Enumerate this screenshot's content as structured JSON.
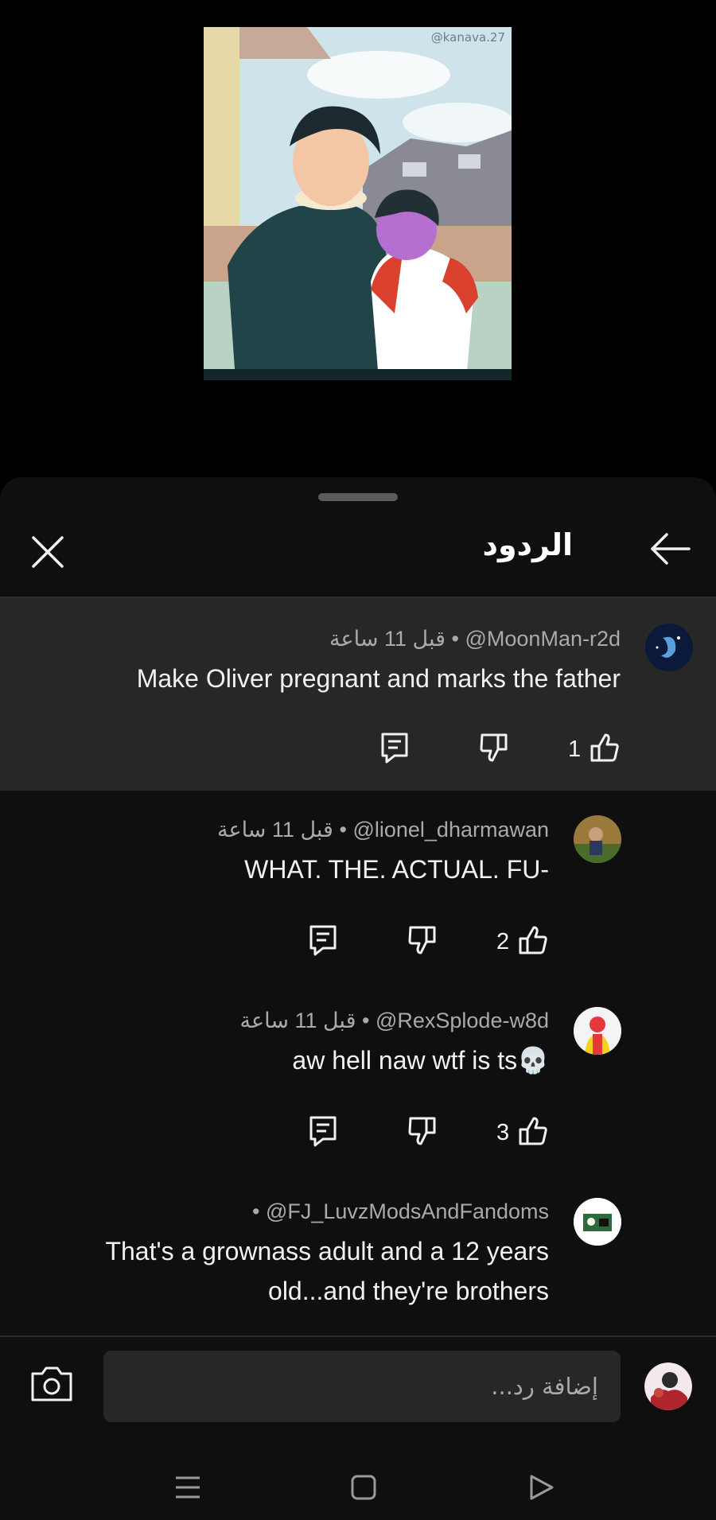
{
  "video": {
    "watermark": "@kanava.27"
  },
  "sheet": {
    "title": "الردود",
    "close_icon": "close-icon",
    "back_icon": "arrow-back-icon"
  },
  "comments": [
    {
      "author": "@MoonMan-r2d",
      "time": "قبل 11 ساعة",
      "text": "Make Oliver pregnant and marks the father",
      "likes": "1",
      "avatar_color": "#0b1a3a",
      "highlighted": true
    },
    {
      "author": "@lionel_dharmawan",
      "time": "قبل 11 ساعة",
      "text": "WHAT. THE. ACTUAL. FU-",
      "likes": "2",
      "avatar_color": "#7a6a3a"
    },
    {
      "author": "@RexSplode-w8d",
      "time": "قبل 11 ساعة",
      "text": "aw hell naw wtf is ts💀",
      "likes": "3",
      "avatar_color": "#f4f4f4"
    },
    {
      "author": "@FJ_LuvzModsAndFandoms",
      "time": "",
      "text_line1": "That's a grownass adult and a 12 years",
      "text_line2": "old...and they're brothers",
      "avatar_color": "#ffffff"
    }
  ],
  "reply": {
    "placeholder": "إضافة رد...",
    "camera_icon": "camera-icon"
  },
  "nav": {
    "recents_icon": "recents-icon",
    "home_icon": "home-icon",
    "back_icon": "nav-back-icon"
  },
  "colors": {
    "sheet_bg": "#0f0f0f",
    "highlight_bg": "#272727",
    "text_primary": "#f1f1f1",
    "text_secondary": "#aaaaaa"
  }
}
